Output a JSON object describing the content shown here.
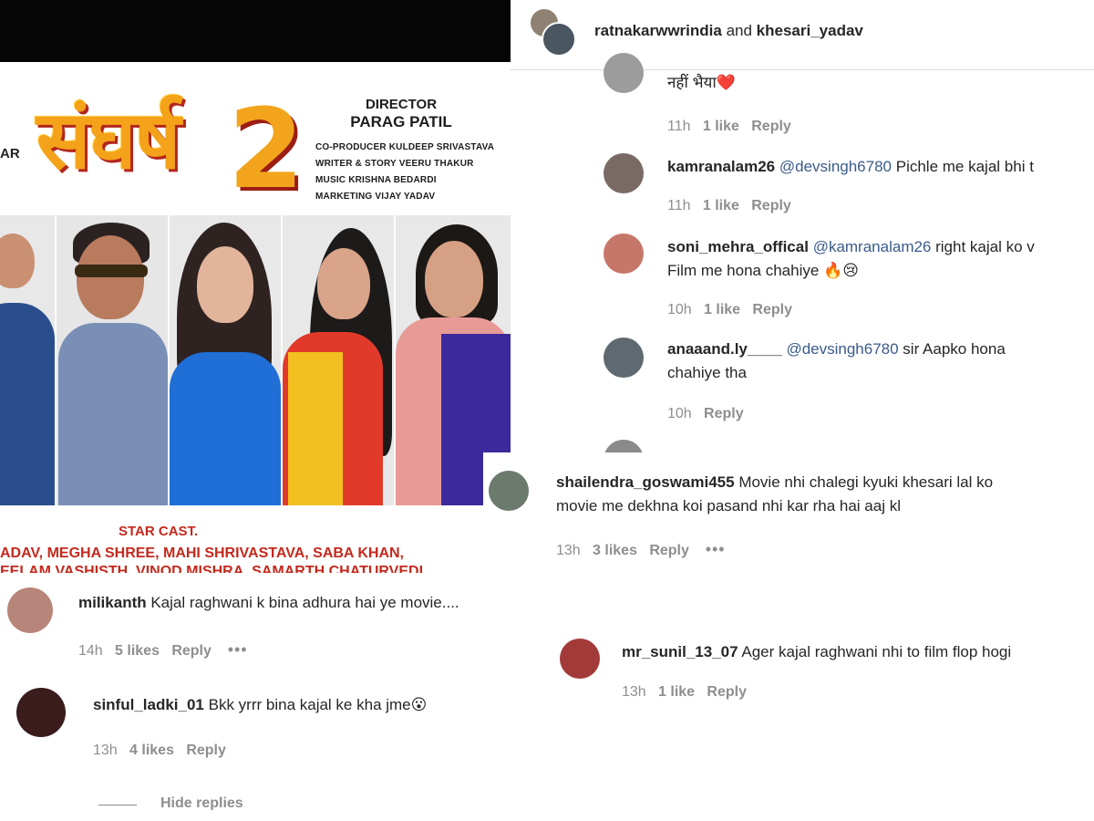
{
  "poster": {
    "title_text": "संघर्ष",
    "title_number": "2",
    "left_fragment": "AR",
    "crew": {
      "director_label": "DIRECTOR",
      "director_name": "PARAG PATIL",
      "co_producer": "CO-PRODUCER KULDEEP SRIVASTAVA",
      "writer": "WRITER & STORY VEERU THAKUR",
      "music": "MUSIC KRISHNA BEDARDI",
      "marketing": "MARKETING VIJAY YADAV"
    },
    "star_cast_label": "STAR CAST.",
    "cast_line_1": "ADAV, MEGHA SHREE, MAHI SHRIVASTAVA, SABA KHAN,",
    "cast_line_2": "EELAM VASHISTH, VINOD MISHRA, SAMARTH CHATURVEDI"
  },
  "post_header": {
    "user1": "ratnakarwwrindia",
    "joiner": "and",
    "user2": "khesari_yadav"
  },
  "thread": [
    {
      "text": "नहीं भैया❤️",
      "time": "11h",
      "likes": "1 like",
      "reply": "Reply"
    },
    {
      "username": "kamranalam26",
      "mention": "@devsingh6780",
      "text": " Pichle me kajal bhi t",
      "time": "11h",
      "likes": "1 like",
      "reply": "Reply"
    },
    {
      "username": "soni_mehra_offical",
      "mention": "@kamranalam26",
      "text": " right kajal ko v",
      "text2": "Film me hona chahiye 🔥😢",
      "time": "10h",
      "likes": "1 like",
      "reply": "Reply"
    },
    {
      "username": "anaaand.ly____",
      "mention": "@devsingh6780",
      "text": " sir Aapko hona",
      "text2": "chahiye tha",
      "time": "10h",
      "reply": "Reply"
    }
  ],
  "comment_shailendra": {
    "username": "shailendra_goswami455",
    "text": " Movie nhi chalegi kyuki khesari lal ko",
    "text2": "movie me dekhna koi pasand nhi kar rha hai aaj kl",
    "time": "13h",
    "likes": "3 likes",
    "reply": "Reply",
    "more": "•••"
  },
  "comment_milikanth": {
    "username": "milikanth",
    "text": " Kajal raghwani k bina adhura hai ye movie....",
    "time": "14h",
    "likes": "5 likes",
    "reply": "Reply",
    "more": "•••"
  },
  "comment_sinful": {
    "username": "sinful_ladki_01",
    "text": " Bkk yrrr bina kajal ke kha jme😮",
    "time": "13h",
    "likes": "4 likes",
    "reply": "Reply",
    "hide_replies": "Hide replies"
  },
  "comment_sunil": {
    "username": "mr_sunil_13_07",
    "text": " Ager kajal raghwani nhi to film flop hogi",
    "time": "13h",
    "likes": "1 like",
    "reply": "Reply"
  },
  "colors": {
    "username": "#262626",
    "meta": "#8e8e8e",
    "mention": "#3b5b8a",
    "poster_red": "#c4291d",
    "poster_orange": "#f4a21a"
  }
}
